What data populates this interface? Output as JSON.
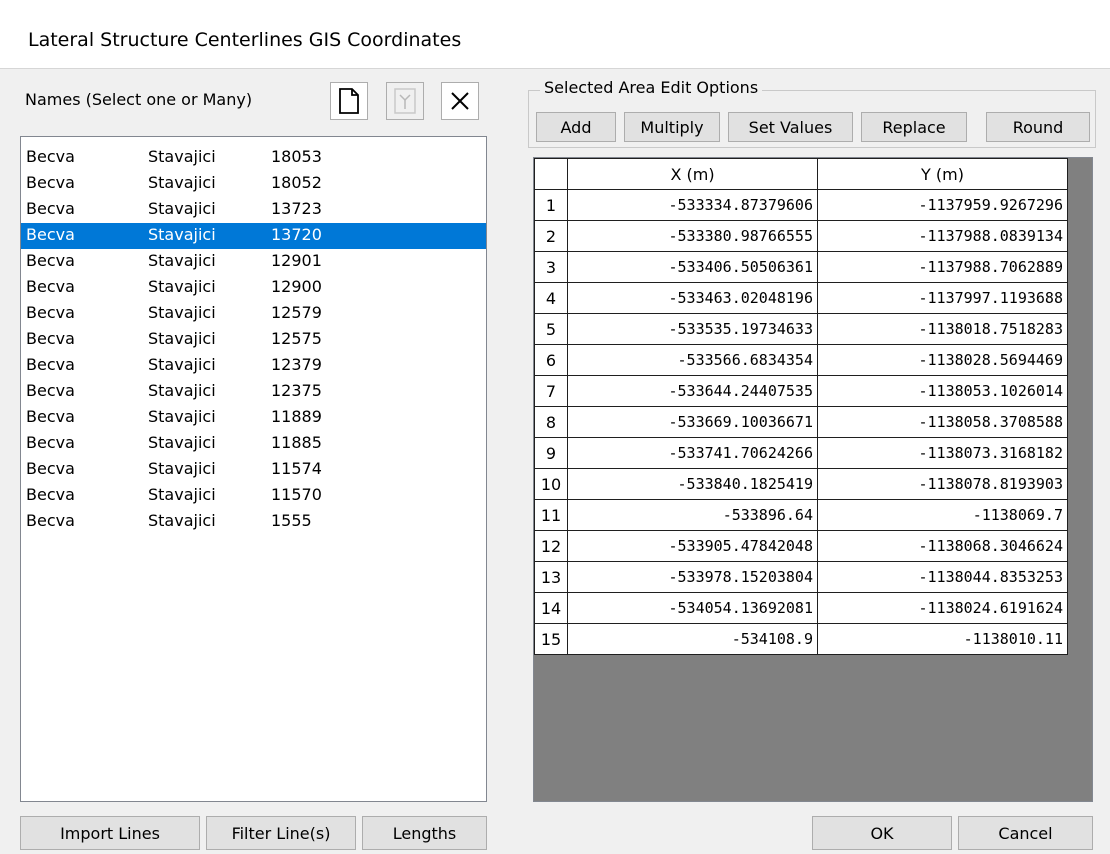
{
  "window": {
    "title": "Lateral Structure Centerlines GIS Coordinates"
  },
  "names_panel": {
    "label": "Names (Select one or Many)",
    "icons": [
      "new-document-icon",
      "import-icon",
      "delete-icon"
    ],
    "items": [
      {
        "col1": "Becva",
        "col2": "Stavajici",
        "col3": "18053",
        "selected": false
      },
      {
        "col1": "Becva",
        "col2": "Stavajici",
        "col3": "18052",
        "selected": false
      },
      {
        "col1": "Becva",
        "col2": "Stavajici",
        "col3": "13723",
        "selected": false
      },
      {
        "col1": "Becva",
        "col2": "Stavajici",
        "col3": "13720",
        "selected": true
      },
      {
        "col1": "Becva",
        "col2": "Stavajici",
        "col3": "12901",
        "selected": false
      },
      {
        "col1": "Becva",
        "col2": "Stavajici",
        "col3": "12900",
        "selected": false
      },
      {
        "col1": "Becva",
        "col2": "Stavajici",
        "col3": "12579",
        "selected": false
      },
      {
        "col1": "Becva",
        "col2": "Stavajici",
        "col3": "12575",
        "selected": false
      },
      {
        "col1": "Becva",
        "col2": "Stavajici",
        "col3": "12379",
        "selected": false
      },
      {
        "col1": "Becva",
        "col2": "Stavajici",
        "col3": "12375",
        "selected": false
      },
      {
        "col1": "Becva",
        "col2": "Stavajici",
        "col3": "11889",
        "selected": false
      },
      {
        "col1": "Becva",
        "col2": "Stavajici",
        "col3": "11885",
        "selected": false
      },
      {
        "col1": "Becva",
        "col2": "Stavajici",
        "col3": "11574",
        "selected": false
      },
      {
        "col1": "Becva",
        "col2": "Stavajici",
        "col3": "11570",
        "selected": false
      },
      {
        "col1": "Becva",
        "col2": "Stavajici",
        "col3": "1555",
        "selected": false
      }
    ]
  },
  "edit_options": {
    "label": "Selected Area Edit Options",
    "buttons": [
      "Add",
      "Multiply",
      "Set Values",
      "Replace",
      "Round"
    ]
  },
  "grid": {
    "headers": [
      "X (m)",
      "Y (m)"
    ],
    "rows": [
      {
        "n": "1",
        "x": "-533334.87379606",
        "y": "-1137959.9267296"
      },
      {
        "n": "2",
        "x": "-533380.98766555",
        "y": "-1137988.0839134"
      },
      {
        "n": "3",
        "x": "-533406.50506361",
        "y": "-1137988.7062889"
      },
      {
        "n": "4",
        "x": "-533463.02048196",
        "y": "-1137997.1193688"
      },
      {
        "n": "5",
        "x": "-533535.19734633",
        "y": "-1138018.7518283"
      },
      {
        "n": "6",
        "x": "-533566.6834354",
        "y": "-1138028.5694469"
      },
      {
        "n": "7",
        "x": "-533644.24407535",
        "y": "-1138053.1026014"
      },
      {
        "n": "8",
        "x": "-533669.10036671",
        "y": "-1138058.3708588"
      },
      {
        "n": "9",
        "x": "-533741.70624266",
        "y": "-1138073.3168182"
      },
      {
        "n": "10",
        "x": "-533840.1825419",
        "y": "-1138078.8193903"
      },
      {
        "n": "11",
        "x": "-533896.64",
        "y": "-1138069.7"
      },
      {
        "n": "12",
        "x": "-533905.47842048",
        "y": "-1138068.3046624"
      },
      {
        "n": "13",
        "x": "-533978.15203804",
        "y": "-1138044.8353253"
      },
      {
        "n": "14",
        "x": "-534054.13692081",
        "y": "-1138024.6191624"
      },
      {
        "n": "15",
        "x": "-534108.9",
        "y": "-1138010.11"
      }
    ]
  },
  "bottom_buttons": {
    "import_lines": "Import Lines",
    "filter_lines": "Filter Line(s)",
    "lengths": "Lengths",
    "ok": "OK",
    "cancel": "Cancel"
  },
  "colors": {
    "selection": "#0078d7",
    "grid_background": "#808080",
    "dialog_background": "#f0f0f0"
  }
}
